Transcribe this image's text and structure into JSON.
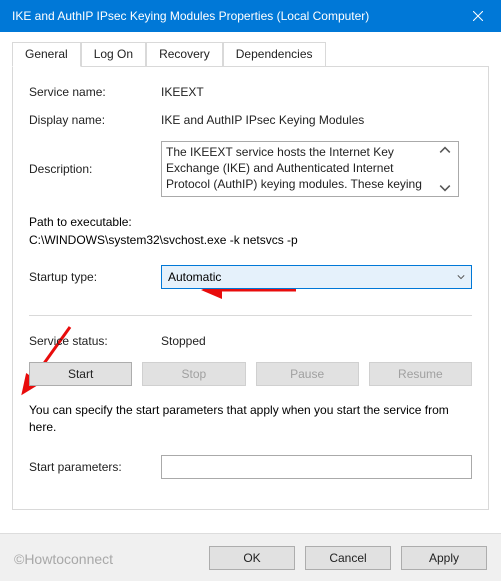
{
  "window": {
    "title": "IKE and AuthIP IPsec Keying Modules Properties (Local Computer)"
  },
  "tabs": {
    "general": "General",
    "logon": "Log On",
    "recovery": "Recovery",
    "dependencies": "Dependencies"
  },
  "general": {
    "service_name_label": "Service name:",
    "service_name_value": "IKEEXT",
    "display_name_label": "Display name:",
    "display_name_value": "IKE and AuthIP IPsec Keying Modules",
    "description_label": "Description:",
    "description_text": "The IKEEXT service hosts the Internet Key Exchange (IKE) and Authenticated Internet Protocol (AuthIP) keying modules. These keying modules are",
    "path_label": "Path to executable:",
    "path_value": "C:\\WINDOWS\\system32\\svchost.exe -k netsvcs -p",
    "startup_type_label": "Startup type:",
    "startup_type_value": "Automatic",
    "service_status_label": "Service status:",
    "service_status_value": "Stopped",
    "buttons": {
      "start": "Start",
      "stop": "Stop",
      "pause": "Pause",
      "resume": "Resume"
    },
    "hint": "You can specify the start parameters that apply when you start the service from here.",
    "start_params_label": "Start parameters:",
    "start_params_value": ""
  },
  "dialog_buttons": {
    "ok": "OK",
    "cancel": "Cancel",
    "apply": "Apply"
  },
  "watermark": "©Howtoconnect"
}
